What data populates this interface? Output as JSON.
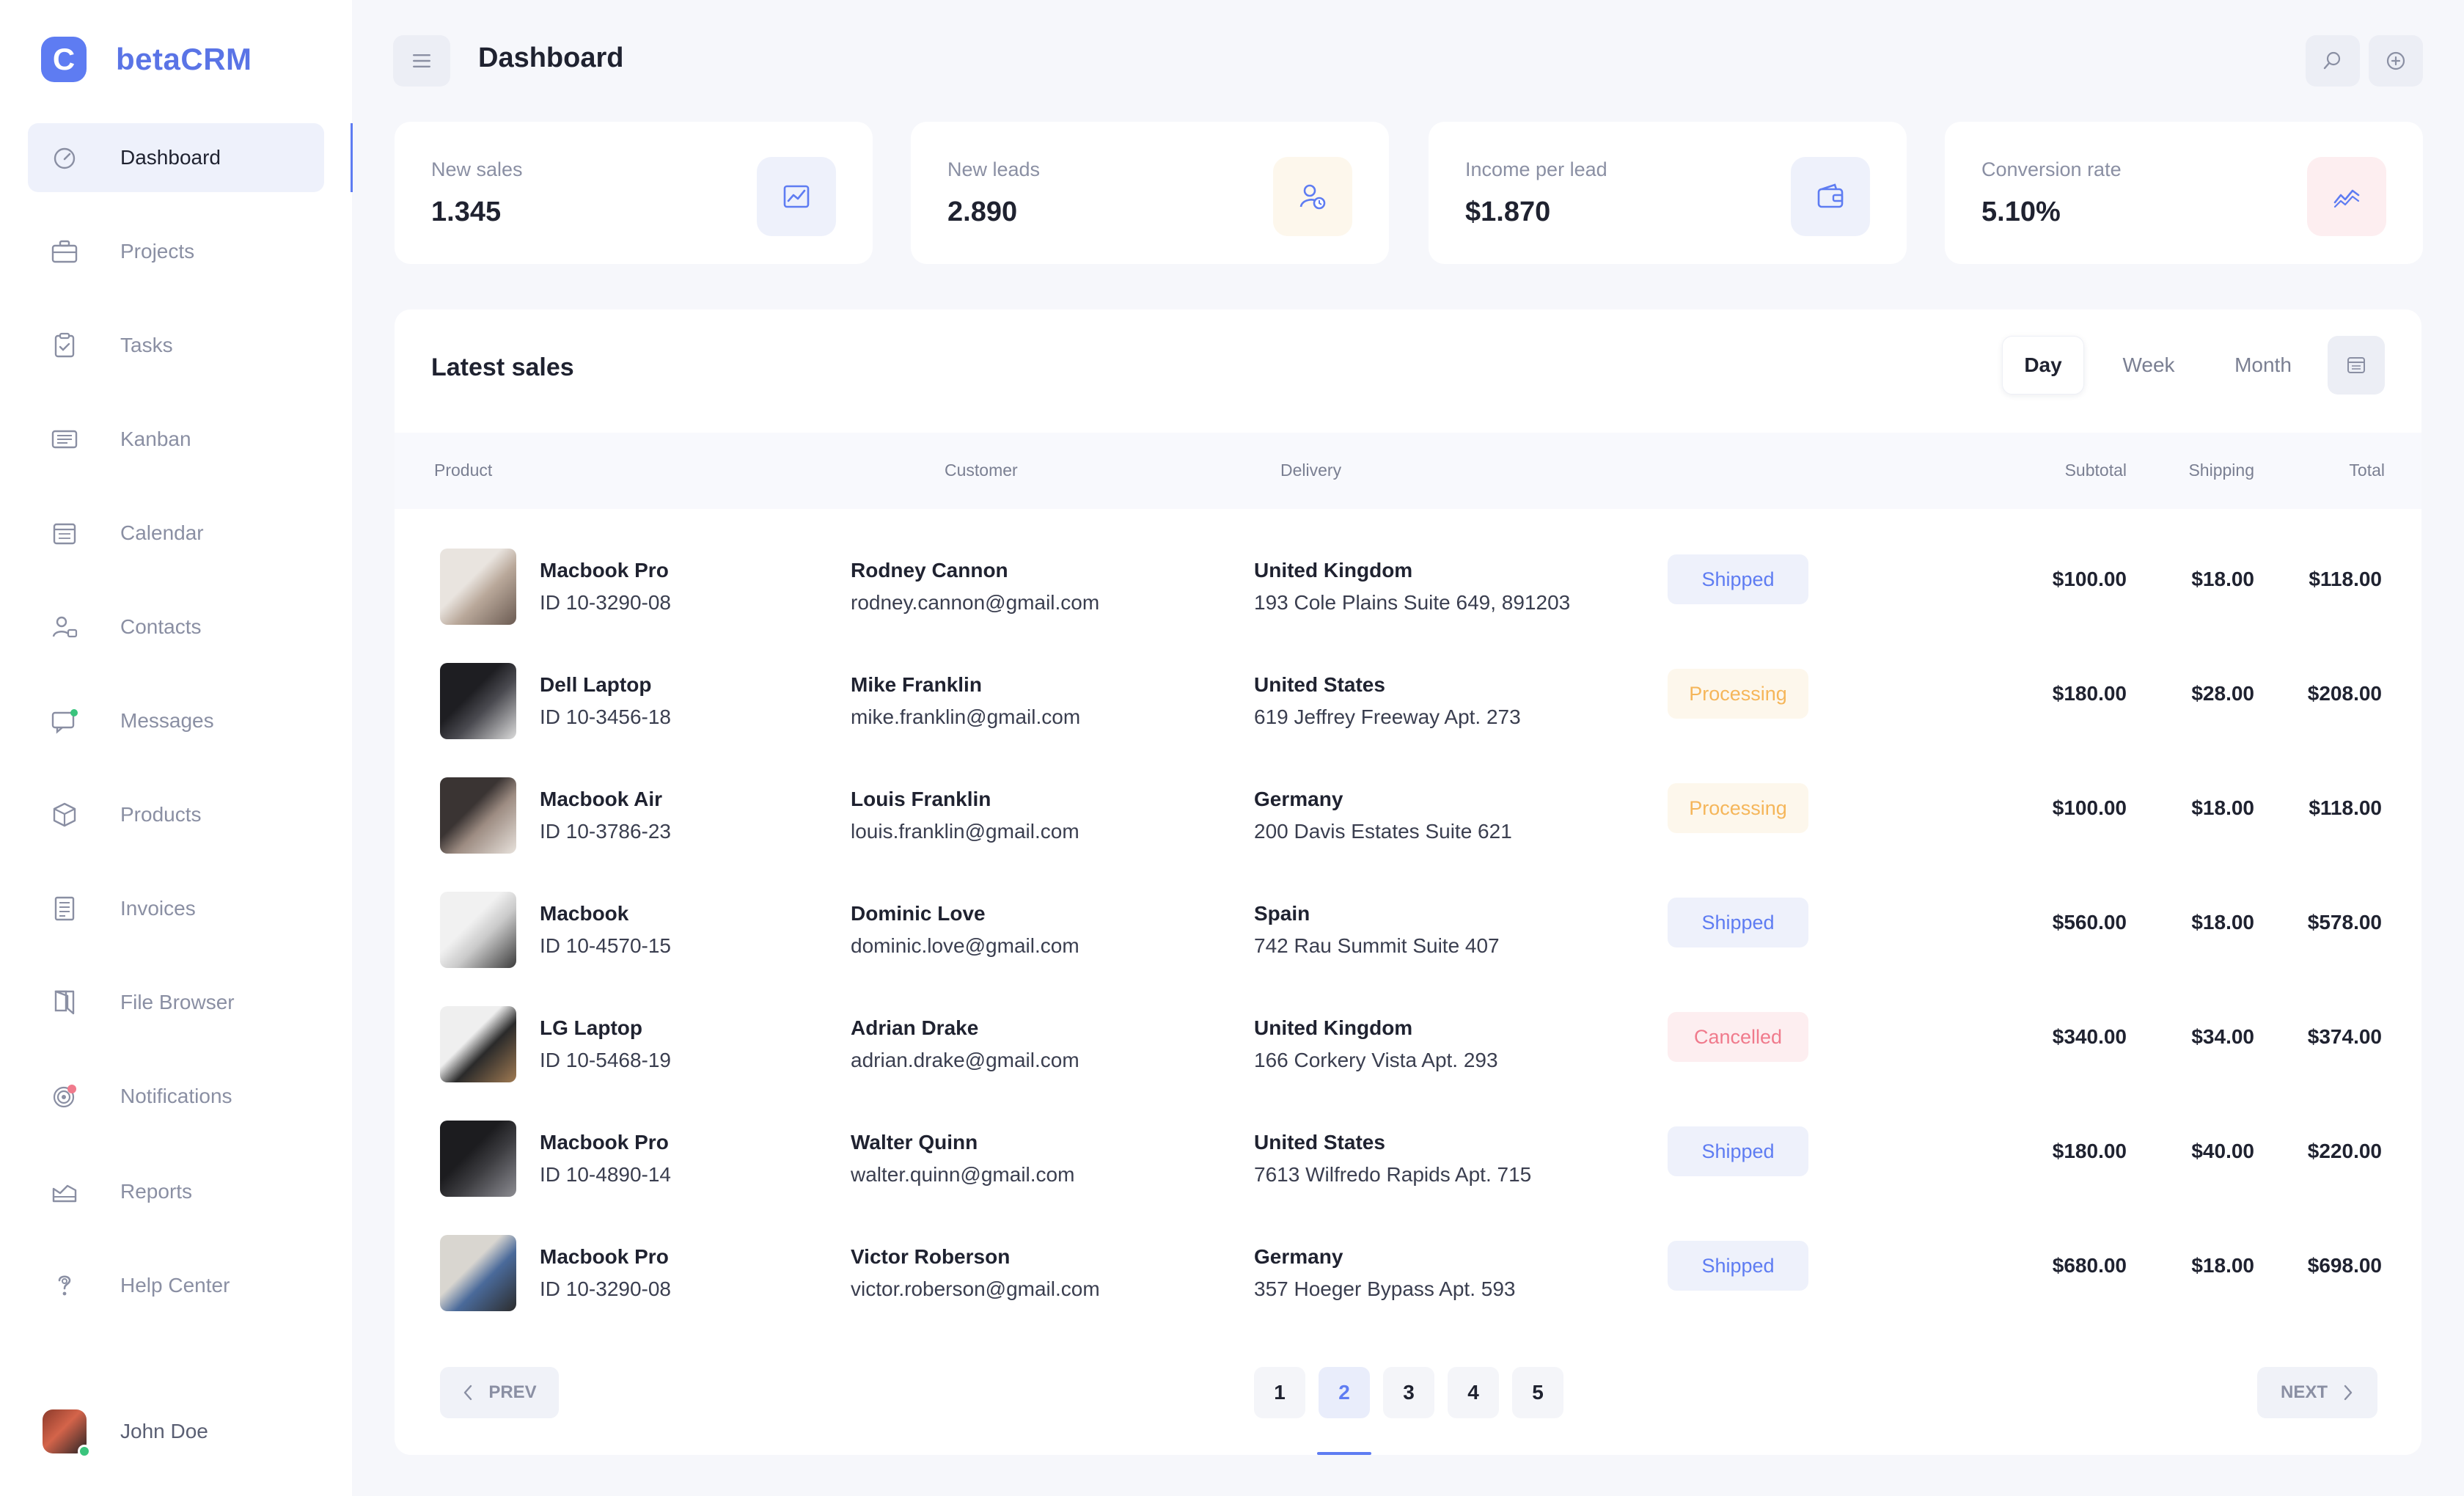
{
  "app": {
    "logo_letter": "C",
    "name": "betaCRM"
  },
  "sidebar": {
    "items": [
      {
        "label": "Dashboard",
        "icon": "dashboard-icon",
        "active": true
      },
      {
        "label": "Projects",
        "icon": "briefcase-icon"
      },
      {
        "label": "Tasks",
        "icon": "clipboard-icon"
      },
      {
        "label": "Kanban",
        "icon": "kanban-icon"
      },
      {
        "label": "Calendar",
        "icon": "calendar-icon"
      },
      {
        "label": "Contacts",
        "icon": "contacts-icon"
      },
      {
        "label": "Messages",
        "icon": "messages-icon"
      },
      {
        "label": "Products",
        "icon": "box-icon"
      },
      {
        "label": "Invoices",
        "icon": "invoice-icon"
      },
      {
        "label": "File Browser",
        "icon": "folder-icon"
      },
      {
        "label": "Notifications",
        "icon": "bell-icon"
      },
      {
        "label": "Reports",
        "icon": "reports-icon"
      },
      {
        "label": "Help Center",
        "icon": "help-icon"
      }
    ],
    "user": {
      "name": "John Doe"
    }
  },
  "header": {
    "title": "Dashboard"
  },
  "stats": [
    {
      "label": "New sales",
      "value": "1.345",
      "icon": "chart-icon",
      "color": "#5e7cf2",
      "bg": "#eef1fb"
    },
    {
      "label": "New leads",
      "value": "2.890",
      "icon": "user-clock-icon",
      "color": "#5e7cf2",
      "bg": "#fdf7ec"
    },
    {
      "label": "Income per lead",
      "value": "$1.870",
      "icon": "wallet-icon",
      "color": "#5e7cf2",
      "bg": "#eef1fb"
    },
    {
      "label": "Conversion rate",
      "value": "5.10%",
      "icon": "trend-icon",
      "color": "#5e7cf2",
      "bg": "#fdeef0"
    }
  ],
  "sales": {
    "title": "Latest sales",
    "filters": [
      "Day",
      "Week",
      "Month"
    ],
    "active_filter": "Day",
    "columns": {
      "product": "Product",
      "customer": "Customer",
      "delivery": "Delivery",
      "subtotal": "Subtotal",
      "shipping": "Shipping",
      "total": "Total"
    },
    "rows": [
      {
        "product": "Macbook Pro",
        "id": "ID 10-3290-08",
        "customer": "Rodney Cannon",
        "email": "rodney.cannon@gmail.com",
        "country": "United Kingdom",
        "address": "193 Cole Plains Suite 649, 891203",
        "status": "Shipped",
        "subtotal": "$100.00",
        "shipping": "$18.00",
        "total": "$118.00"
      },
      {
        "product": "Dell Laptop",
        "id": "ID 10-3456-18",
        "customer": "Mike Franklin",
        "email": "mike.franklin@gmail.com",
        "country": "United States",
        "address": "619 Jeffrey Freeway Apt. 273",
        "status": "Processing",
        "subtotal": "$180.00",
        "shipping": "$28.00",
        "total": "$208.00"
      },
      {
        "product": "Macbook Air",
        "id": "ID 10-3786-23",
        "customer": "Louis Franklin",
        "email": "louis.franklin@gmail.com",
        "country": "Germany",
        "address": "200 Davis Estates Suite 621",
        "status": "Processing",
        "subtotal": "$100.00",
        "shipping": "$18.00",
        "total": "$118.00"
      },
      {
        "product": "Macbook",
        "id": "ID 10-4570-15",
        "customer": "Dominic Love",
        "email": "dominic.love@gmail.com",
        "country": "Spain",
        "address": "742 Rau Summit Suite 407",
        "status": "Shipped",
        "subtotal": "$560.00",
        "shipping": "$18.00",
        "total": "$578.00"
      },
      {
        "product": "LG Laptop",
        "id": "ID 10-5468-19",
        "customer": "Adrian Drake",
        "email": "adrian.drake@gmail.com",
        "country": "United Kingdom",
        "address": "166 Corkery Vista Apt. 293",
        "status": "Cancelled",
        "subtotal": "$340.00",
        "shipping": "$34.00",
        "total": "$374.00"
      },
      {
        "product": "Macbook  Pro",
        "id": "ID 10-4890-14",
        "customer": "Walter Quinn",
        "email": "walter.quinn@gmail.com",
        "country": "United States",
        "address": "7613 Wilfredo Rapids Apt. 715",
        "status": "Shipped",
        "subtotal": "$180.00",
        "shipping": "$40.00",
        "total": "$220.00"
      },
      {
        "product": "Macbook Pro",
        "id": "ID 10-3290-08",
        "customer": "Victor Roberson",
        "email": "victor.roberson@gmail.com",
        "country": "Germany",
        "address": "357 Hoeger Bypass Apt. 593",
        "status": "Shipped",
        "subtotal": "$680.00",
        "shipping": "$18.00",
        "total": "$698.00"
      }
    ],
    "status_colors": {
      "Shipped": {
        "fg": "#5e7cf2",
        "bg": "#eef1fb"
      },
      "Processing": {
        "fg": "#f5b65a",
        "bg": "#fdf7ec"
      },
      "Cancelled": {
        "fg": "#f07a8c",
        "bg": "#fdeef0"
      }
    }
  },
  "pagination": {
    "prev": "PREV",
    "next": "NEXT",
    "pages": [
      "1",
      "2",
      "3",
      "4",
      "5"
    ],
    "current": "2"
  }
}
